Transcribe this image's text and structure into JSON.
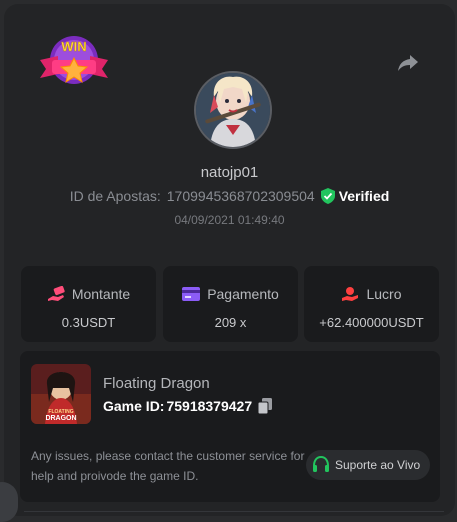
{
  "header": {
    "badge_text": "WIN",
    "share_icon": "share-icon"
  },
  "profile": {
    "username": "natojp01",
    "bet_id_label": "ID de Apostas:",
    "bet_id": "1709945368702309504",
    "verified_label": "Verified",
    "timestamp": "04/09/2021 01:49:40"
  },
  "stats": [
    {
      "label": "Montante",
      "value": "0.3USDT",
      "icon": "money-hand-icon",
      "color": "#ff4d7a"
    },
    {
      "label": "Pagamento",
      "value": "209 x",
      "icon": "card-icon",
      "color": "#8b5cf6"
    },
    {
      "label": "Lucro",
      "value": "+62.400000USDT",
      "icon": "profit-hand-icon",
      "color": "#ff4040"
    }
  ],
  "game": {
    "name": "Floating Dragon",
    "id_label": "Game ID:",
    "id_value": "75918379427",
    "thumb_title": "FLOATING",
    "thumb_subtitle": "DRAGON",
    "help_text": "Any issues, please contact the customer service for help and proivode the game ID.",
    "support_label": "Suporte ao Vivo"
  },
  "colors": {
    "background": "#232426",
    "card": "#1a1b1d",
    "verified_green": "#22c55e",
    "support_green": "#22c55e"
  }
}
